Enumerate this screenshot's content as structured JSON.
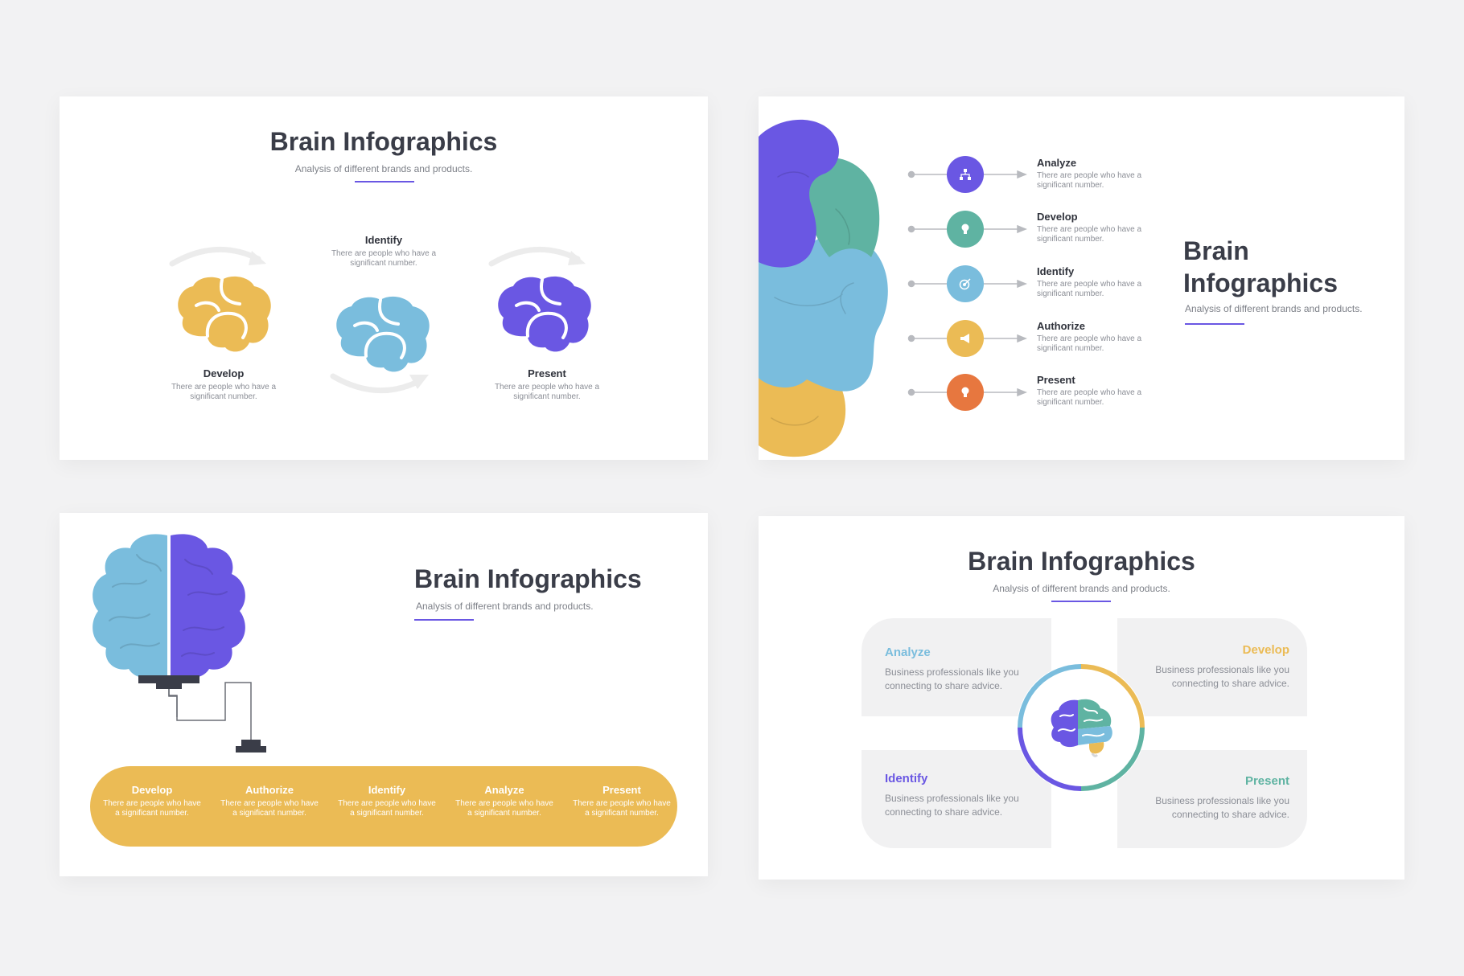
{
  "colors": {
    "purple": "#6a57e3",
    "teal": "#5fb3a2",
    "blue": "#7abddd",
    "yellow": "#ebbb55",
    "orange": "#e7773f",
    "dark": "#3a3d48",
    "muted": "#8b8e96"
  },
  "slide1": {
    "title": "Brain Infographics",
    "subtitle": "Analysis of different brands and products.",
    "steps": [
      {
        "label": "Develop",
        "desc": "There are people who have a significant number.",
        "color": "#ebbb55"
      },
      {
        "label": "Identify",
        "desc": "There are people who have a significant number.",
        "color": "#7abddd"
      },
      {
        "label": "Present",
        "desc": "There are people who have a significant number.",
        "color": "#6a57e3"
      }
    ]
  },
  "slide2": {
    "title_line1": "Brain",
    "title_line2": "Infographics",
    "subtitle": "Analysis of different brands and products.",
    "rows": [
      {
        "label": "Analyze",
        "desc": "There are people who have a significant number.",
        "color": "#6a57e3",
        "icon": "hierarchy-icon"
      },
      {
        "label": "Develop",
        "desc": "There are people who have a significant number.",
        "color": "#5fb3a2",
        "icon": "lightbulb-icon"
      },
      {
        "label": "Identify",
        "desc": "There are people who have a significant number.",
        "color": "#7abddd",
        "icon": "target-icon"
      },
      {
        "label": "Authorize",
        "desc": "There are people who have a significant number.",
        "color": "#ebbb55",
        "icon": "megaphone-icon"
      },
      {
        "label": "Present",
        "desc": "There are people who have a significant number.",
        "color": "#e7773f",
        "icon": "lightbulb-icon"
      }
    ]
  },
  "slide3": {
    "title": "Brain Infographics",
    "subtitle": "Analysis of different brands and products.",
    "items": [
      {
        "label": "Develop",
        "desc": "There are people who have a significant number."
      },
      {
        "label": "Authorize",
        "desc": "There are people who have a significant number."
      },
      {
        "label": "Identify",
        "desc": "There are people who have a significant number."
      },
      {
        "label": "Analyze",
        "desc": "There are people who have a significant number."
      },
      {
        "label": "Present",
        "desc": "There are people who have a significant number."
      }
    ]
  },
  "slide4": {
    "title": "Brain Infographics",
    "subtitle": "Analysis of different brands and products.",
    "cards": [
      {
        "label": "Analyze",
        "desc": "Business professionals like you connecting to share advice.",
        "color": "#7abddd"
      },
      {
        "label": "Develop",
        "desc": "Business professionals like you connecting to share advice.",
        "color": "#ebbb55"
      },
      {
        "label": "Identify",
        "desc": "Business professionals like you connecting to share advice.",
        "color": "#6a57e3"
      },
      {
        "label": "Present",
        "desc": "Business professionals like you connecting to share advice.",
        "color": "#5fb3a2"
      }
    ]
  }
}
